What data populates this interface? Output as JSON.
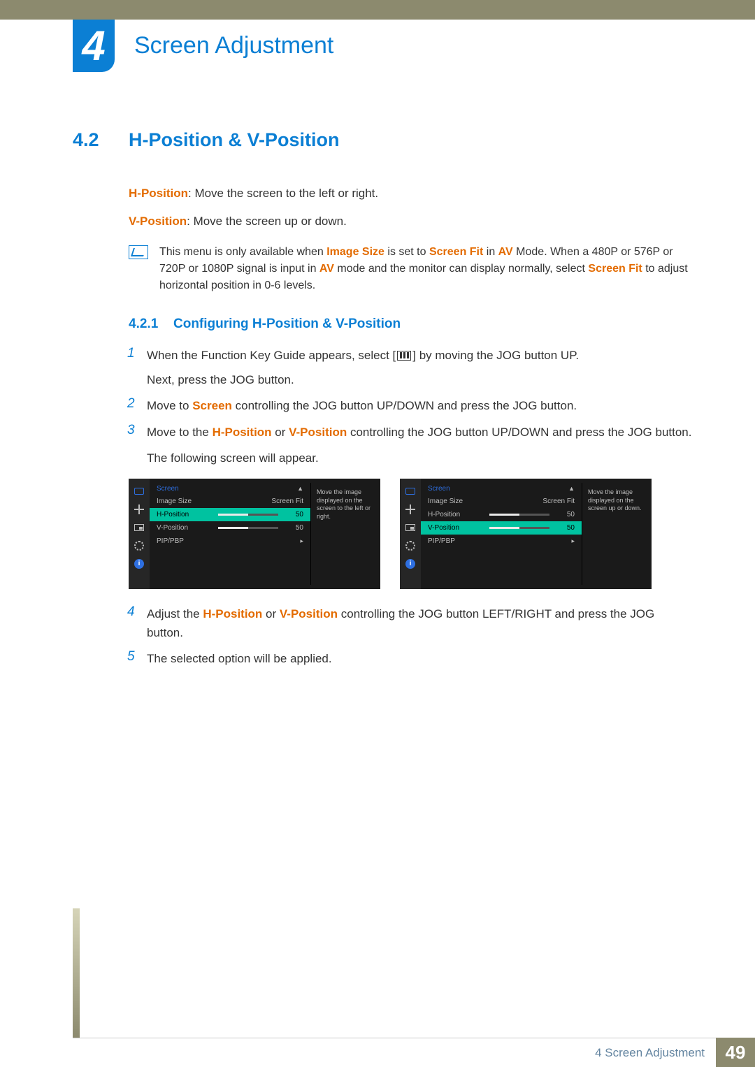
{
  "chapter": {
    "number": "4",
    "title": "Screen Adjustment"
  },
  "section": {
    "number": "4.2",
    "title": "H-Position & V-Position"
  },
  "definitions": {
    "hpos_label": "H-Position",
    "hpos_text": ": Move the screen to the left or right.",
    "vpos_label": "V-Position",
    "vpos_text": ": Move the screen up or down."
  },
  "note": {
    "pre": "This menu is only available when ",
    "imgsize": "Image Size",
    "t1": " is set to ",
    "screenfit": "Screen Fit",
    "t2": " in ",
    "av": "AV",
    "t3": " Mode. When a 480P or 576P or 720P or 1080P signal is input in ",
    "av2": "AV",
    "t4": " mode and the monitor can display normally, select ",
    "screenfit2": "Screen Fit",
    "t5": " to adjust horizontal position in 0-6 levels."
  },
  "subsection": {
    "number": "4.2.1",
    "title": "Configuring H-Position & V-Position"
  },
  "steps": {
    "s1a": "When the Function Key Guide appears, select [",
    "s1b": "] by moving the JOG button UP.",
    "s1c": "Next, press the JOG button.",
    "s2a": "Move to ",
    "s2_screen": "Screen",
    "s2b": " controlling the JOG button UP/DOWN and press the JOG button.",
    "s3a": "Move to the ",
    "s3_h": "H-Position",
    "s3_or": " or ",
    "s3_v": "V-Position",
    "s3b": " controlling the JOG button UP/DOWN and press the JOG button.",
    "s3c": "The following screen will appear.",
    "s4a": "Adjust the ",
    "s4_h": "H-Position",
    "s4_or": " or ",
    "s4_v": "V-Position",
    "s4b": " controlling the JOG button LEFT/RIGHT and press the JOG button.",
    "s5": "The selected option will be applied."
  },
  "osd": {
    "head": "Screen",
    "imgsize": "Image Size",
    "imgsize_val": "Screen Fit",
    "hpos": "H-Position",
    "vpos": "V-Position",
    "pip": "PIP/PBP",
    "val50": "50",
    "help_left": "Move the image displayed on the screen to the left or right.",
    "help_right": "Move the image displayed on the screen up or down."
  },
  "footer": {
    "label": "4 Screen Adjustment",
    "page": "49"
  }
}
